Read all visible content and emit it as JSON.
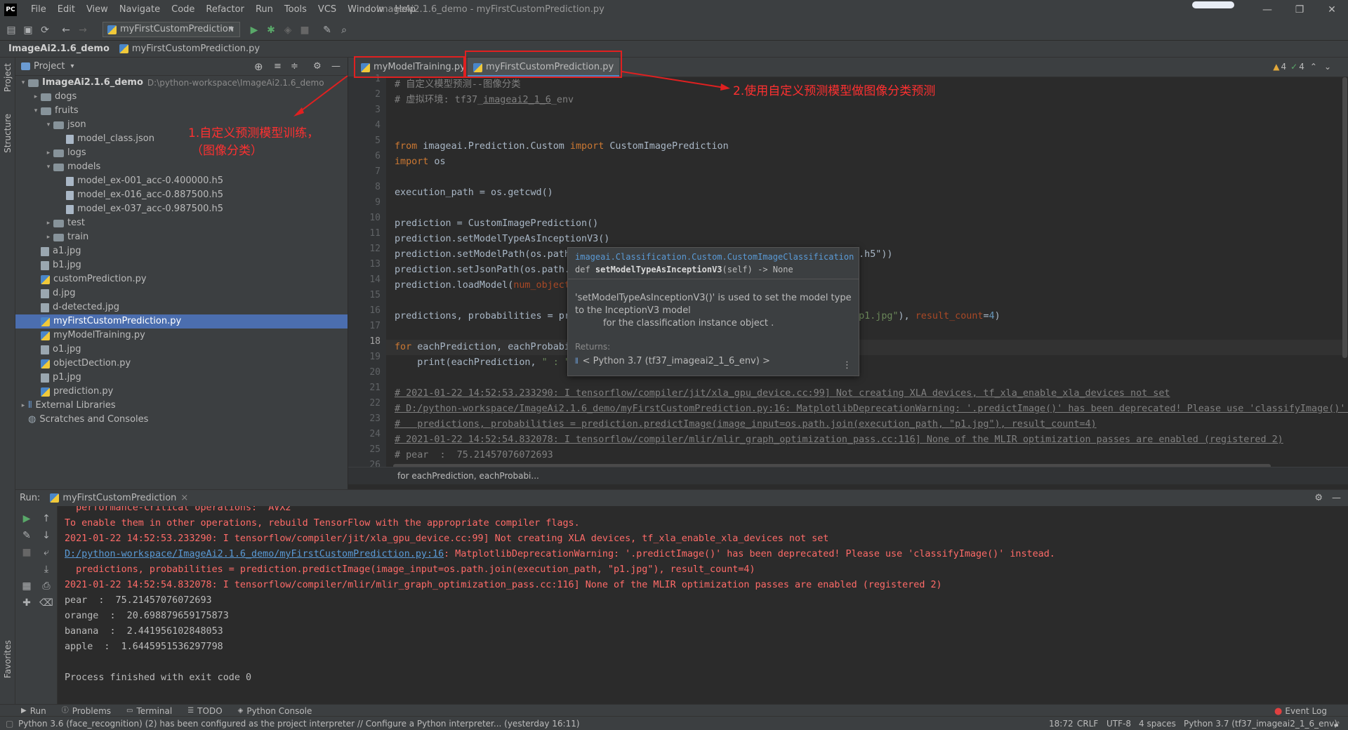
{
  "app": {
    "window_title": "ImageAi2.1.6_demo - myFirstCustomPrediction.py",
    "menu": [
      "File",
      "Edit",
      "View",
      "Navigate",
      "Code",
      "Refactor",
      "Run",
      "Tools",
      "VCS",
      "Window",
      "Help"
    ],
    "run_config": "myFirstCustomPrediction"
  },
  "breadcrumb": {
    "project": "ImageAi2.1.6_demo",
    "file": "myFirstCustomPrediction.py"
  },
  "left_strip": {
    "project": "Project",
    "structure": "Structure",
    "favorites": "Favorites"
  },
  "project_panel": {
    "title": "Project",
    "root_name": "ImageAi2.1.6_demo",
    "root_path": "D:\\python-workspace\\ImageAi2.1.6_demo",
    "items": [
      {
        "label": "dogs",
        "kind": "folder",
        "depth": 1,
        "arrow": "▸"
      },
      {
        "label": "fruits",
        "kind": "folder",
        "depth": 1,
        "arrow": "▾"
      },
      {
        "label": "json",
        "kind": "folder",
        "depth": 2,
        "arrow": "▾"
      },
      {
        "label": "model_class.json",
        "kind": "file",
        "depth": 3,
        "arrow": ""
      },
      {
        "label": "logs",
        "kind": "folder",
        "depth": 2,
        "arrow": "▸"
      },
      {
        "label": "models",
        "kind": "folder",
        "depth": 2,
        "arrow": "▾"
      },
      {
        "label": "model_ex-001_acc-0.400000.h5",
        "kind": "file",
        "depth": 3,
        "arrow": ""
      },
      {
        "label": "model_ex-016_acc-0.887500.h5",
        "kind": "file",
        "depth": 3,
        "arrow": ""
      },
      {
        "label": "model_ex-037_acc-0.987500.h5",
        "kind": "file",
        "depth": 3,
        "arrow": ""
      },
      {
        "label": "test",
        "kind": "folder",
        "depth": 2,
        "arrow": "▸"
      },
      {
        "label": "train",
        "kind": "folder",
        "depth": 2,
        "arrow": "▸"
      },
      {
        "label": "a1.jpg",
        "kind": "jpg",
        "depth": 1,
        "arrow": ""
      },
      {
        "label": "b1.jpg",
        "kind": "jpg",
        "depth": 1,
        "arrow": ""
      },
      {
        "label": "customPrediction.py",
        "kind": "py",
        "depth": 1,
        "arrow": ""
      },
      {
        "label": "d.jpg",
        "kind": "jpg",
        "depth": 1,
        "arrow": ""
      },
      {
        "label": "d-detected.jpg",
        "kind": "jpg",
        "depth": 1,
        "arrow": ""
      },
      {
        "label": "myFirstCustomPrediction.py",
        "kind": "py",
        "depth": 1,
        "arrow": "",
        "selected": true
      },
      {
        "label": "myModelTraining.py",
        "kind": "py",
        "depth": 1,
        "arrow": ""
      },
      {
        "label": "o1.jpg",
        "kind": "jpg",
        "depth": 1,
        "arrow": ""
      },
      {
        "label": "objectDection.py",
        "kind": "py",
        "depth": 1,
        "arrow": ""
      },
      {
        "label": "p1.jpg",
        "kind": "jpg",
        "depth": 1,
        "arrow": ""
      },
      {
        "label": "prediction.py",
        "kind": "py",
        "depth": 1,
        "arrow": ""
      }
    ],
    "external_libraries": "External Libraries",
    "scratches": "Scratches and Consoles"
  },
  "tabs": [
    {
      "label": "myModelTraining.py",
      "close": "×"
    },
    {
      "label": "myFirstCustomPrediction.py",
      "close": "×",
      "active": true
    }
  ],
  "editor": {
    "inspection": {
      "warnings": "4",
      "weak": "4"
    },
    "line_numbers": [
      "1",
      "2",
      "3",
      "4",
      "5",
      "6",
      "7",
      "8",
      "9",
      "10",
      "11",
      "12",
      "13",
      "14",
      "15",
      "16",
      "17",
      "18",
      "19",
      "20",
      "21",
      "22",
      "23",
      "24",
      "25",
      "26"
    ],
    "current_line": "18",
    "context_line": "for eachPrediction, eachProbabi..."
  },
  "tooltip": {
    "qualified": "imageai.Classification.Custom.CustomImageClassification",
    "signature_prefix": "def ",
    "signature_name": "setModelTypeAsInceptionV3",
    "signature_suffix": "(self) -> None",
    "doc_line1": "'setModelTypeAsInceptionV3()' is used to set the model type",
    "doc_line2": "to the InceptionV3 model",
    "doc_line3": "for the classification instance object .",
    "returns_label": "Returns:",
    "returns_value": "< Python 3.7 (tf37_imageai2_1_6_env) >"
  },
  "annotations": {
    "left_line1": "1.自定义预测模型训练，",
    "left_line2": "（图像分类）",
    "right": "2.使用自定义预测模型做图像分类预测"
  },
  "run": {
    "label": "Run:",
    "config": "myFirstCustomPrediction",
    "output": [
      {
        "text": "  performance-critical operations:  AVX2",
        "cls": "cr"
      },
      {
        "text": "To enable them in other operations, rebuild TensorFlow with the appropriate compiler flags.",
        "cls": "cr"
      },
      {
        "text": "2021-01-22 14:52:53.233290: I tensorflow/compiler/jit/xla_gpu_device.cc:99] Not creating XLA devices, tf_xla_enable_xla_devices not set",
        "cls": "cr"
      },
      {
        "text": "",
        "cls": "cr",
        "link": "D:/python-workspace/ImageAi2.1.6_demo/myFirstCustomPrediction.py:16",
        "rest": ": MatplotlibDeprecationWarning: '.predictImage()' has been deprecated! Please use 'classifyImage()' instead."
      },
      {
        "text": "  predictions, probabilities = prediction.predictImage(image_input=os.path.join(execution_path, \"p1.jpg\"), result_count=4)",
        "cls": "cr"
      },
      {
        "text": "2021-01-22 14:52:54.832078: I tensorflow/compiler/mlir/mlir_graph_optimization_pass.cc:116] None of the MLIR optimization passes are enabled (registered 2)",
        "cls": "cr"
      },
      {
        "text": "pear  :  75.21457076072693",
        "cls": ""
      },
      {
        "text": "orange  :  20.698879659175873",
        "cls": ""
      },
      {
        "text": "banana  :  2.441956102848053",
        "cls": ""
      },
      {
        "text": "apple  :  1.6445951536297798",
        "cls": ""
      },
      {
        "text": "",
        "cls": ""
      },
      {
        "text": "Process finished with exit code 0",
        "cls": ""
      }
    ]
  },
  "bottom_tools": [
    "Run",
    "Problems",
    "Terminal",
    "TODO",
    "Python Console"
  ],
  "event_log": "Event Log",
  "status": {
    "message": "Python 3.6 (face_recognition) (2) has been configured as the project interpreter // Configure a Python interpreter... (yesterday 16:11)",
    "position": "18:72",
    "line_sep": "CRLF",
    "encoding": "UTF-8",
    "indent": "4 spaces",
    "interpreter": "Python 3.7 (tf37_imageai2_1_6_env)"
  }
}
